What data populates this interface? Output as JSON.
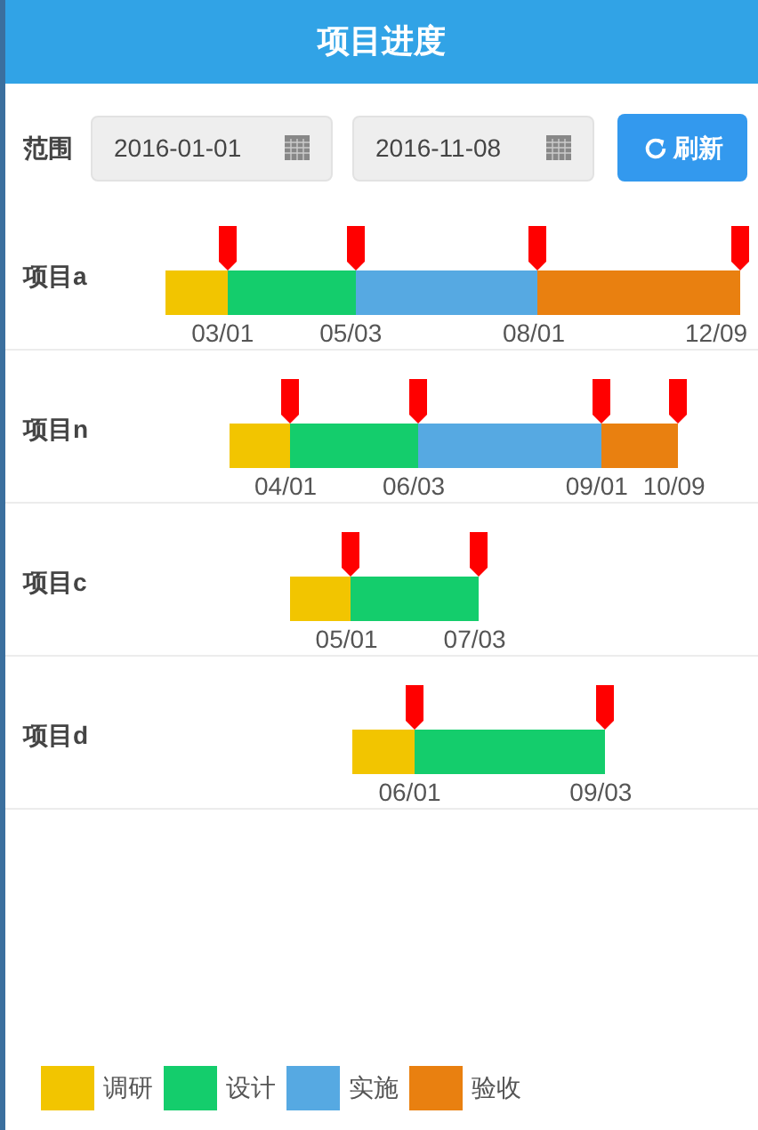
{
  "header": {
    "title": "项目进度"
  },
  "toolbar": {
    "range_label": "范围",
    "start_date": "2016-01-01",
    "end_date": "2016-11-08",
    "refresh_button": "刷新"
  },
  "projects": [
    {
      "name": "项目a",
      "phases": [
        {
          "kind": "research",
          "end": "03/01"
        },
        {
          "kind": "design",
          "end": "05/03"
        },
        {
          "kind": "build",
          "end": "08/01"
        },
        {
          "kind": "accept",
          "end": "12/09"
        }
      ]
    },
    {
      "name": "项目n",
      "phases": [
        {
          "kind": "research",
          "end": "04/01"
        },
        {
          "kind": "design",
          "end": "06/03"
        },
        {
          "kind": "build",
          "end": "09/01"
        },
        {
          "kind": "accept",
          "end": "10/09"
        }
      ]
    },
    {
      "name": "项目c",
      "phases": [
        {
          "kind": "research",
          "end": "05/01"
        },
        {
          "kind": "design",
          "end": "07/03"
        }
      ]
    },
    {
      "name": "项目d",
      "phases": [
        {
          "kind": "research",
          "end": "06/01"
        },
        {
          "kind": "design",
          "end": "09/03"
        }
      ]
    }
  ],
  "legend": [
    {
      "kind": "research",
      "label": "调研",
      "color": "#f2c500"
    },
    {
      "kind": "design",
      "label": "设计",
      "color": "#14cd6c"
    },
    {
      "kind": "build",
      "label": "实施",
      "color": "#56a9e2"
    },
    {
      "kind": "accept",
      "label": "验收",
      "color": "#e98010"
    }
  ]
}
